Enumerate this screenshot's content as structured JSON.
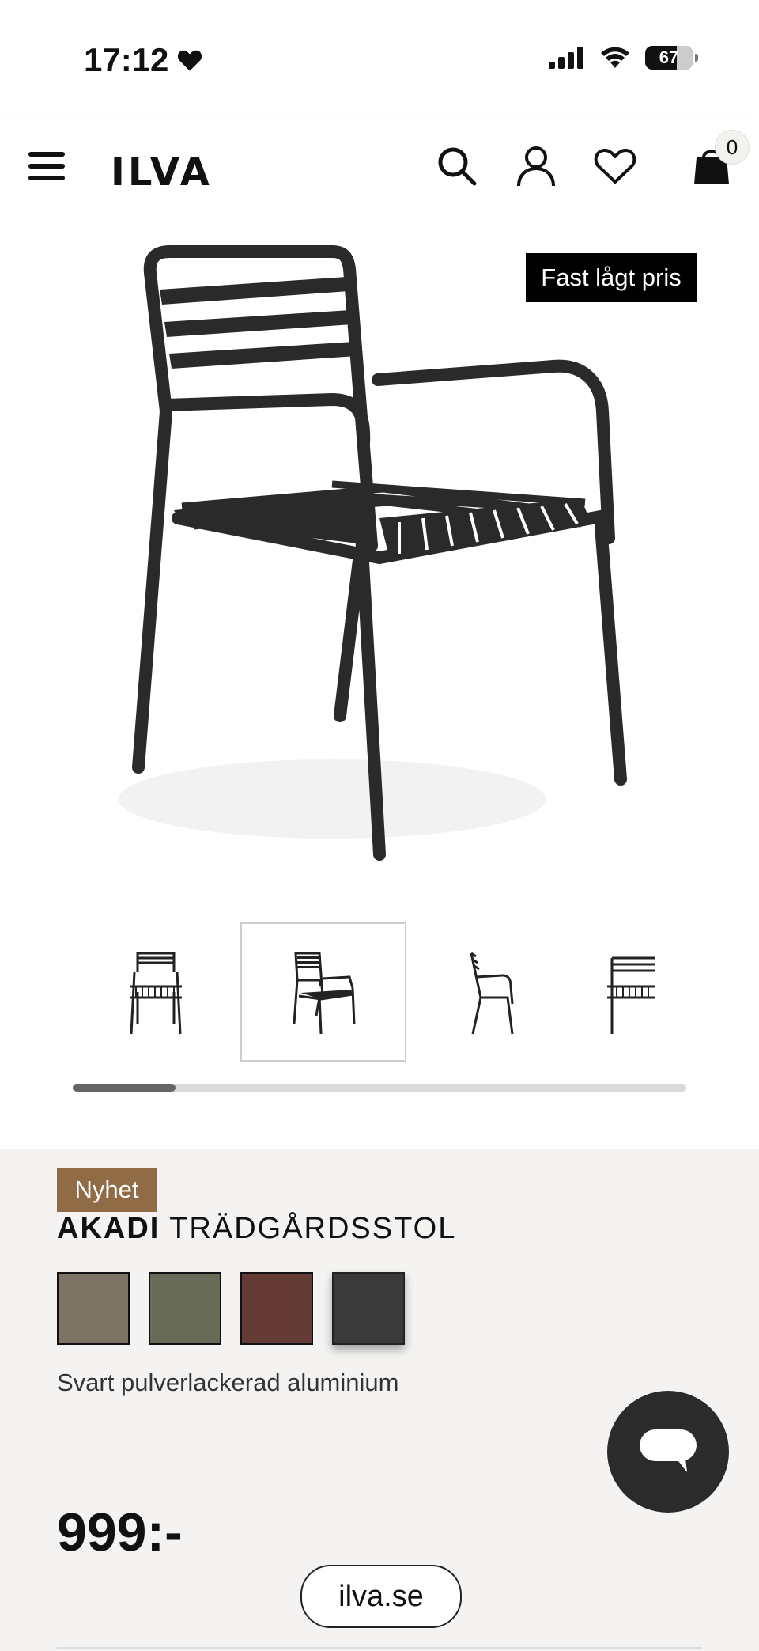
{
  "status_bar": {
    "time": "17:12",
    "battery": "67"
  },
  "header": {
    "logo": "ILVA",
    "cart_count": "0"
  },
  "hero": {
    "badge": "Fast lågt pris"
  },
  "gallery": {
    "thumbnails": [
      "front-view",
      "angled-view",
      "side-view",
      "partial-view"
    ],
    "selected_index": 1
  },
  "product": {
    "tag": "Nyhet",
    "brand": "AKADI",
    "name": "TRÄDGÅRDSSTOL",
    "swatches": [
      {
        "color": "#7d7466"
      },
      {
        "color": "#676b57"
      },
      {
        "color": "#643a34"
      },
      {
        "color": "#3a3a3a",
        "selected": true
      }
    ],
    "material": "Svart pulverlackerad aluminium",
    "price": "999:-"
  },
  "browser": {
    "url": "ilva.se"
  }
}
